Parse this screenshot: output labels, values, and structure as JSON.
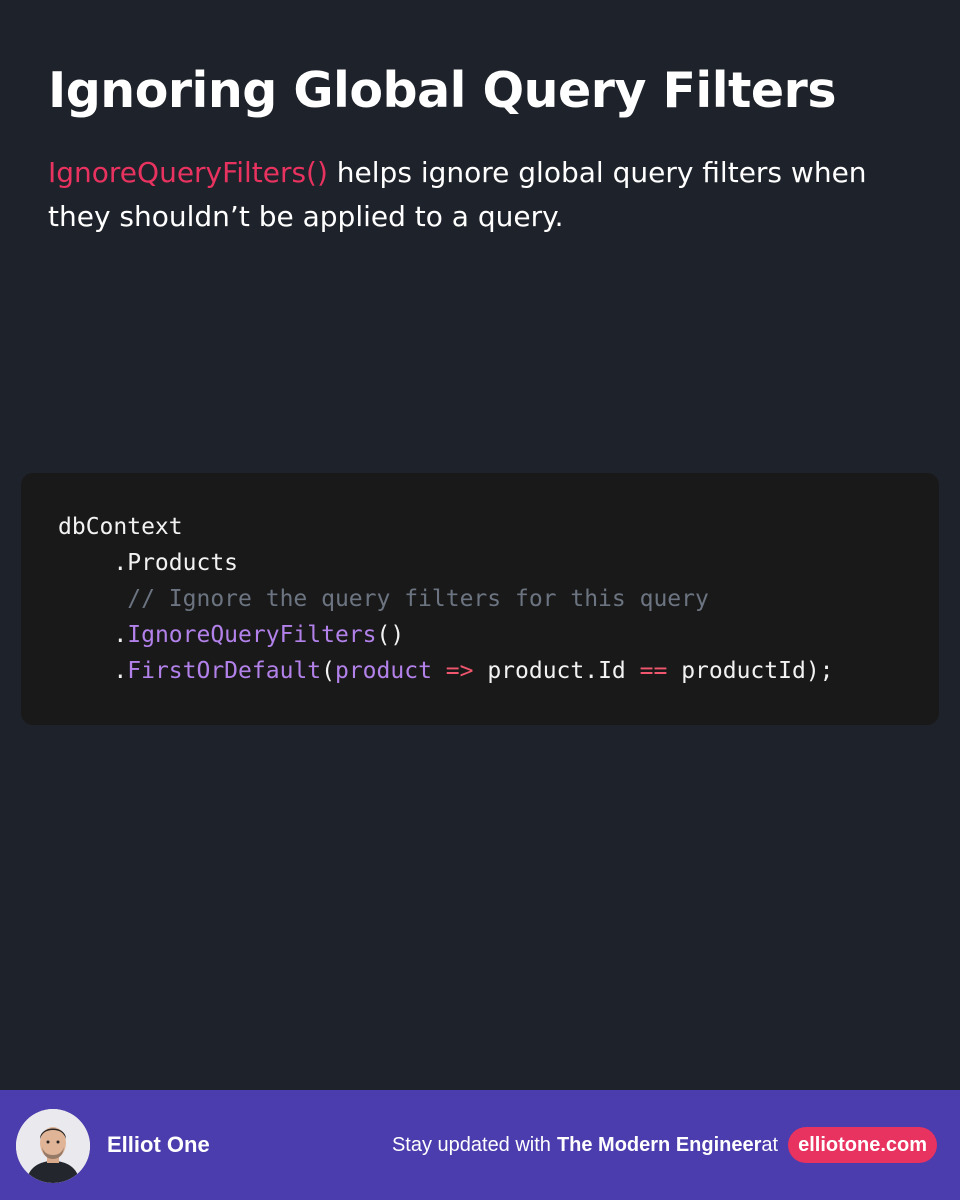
{
  "header": {
    "title": "Ignoring Global Query Filters",
    "subtitle_highlight": "IgnoreQueryFilters()",
    "subtitle_rest": " helps ignore global query filters when they shouldn’t be applied to a query."
  },
  "code": {
    "line1": "dbContext",
    "line2": "    .Products",
    "line3_indent": "     ",
    "line3_comment": "// Ignore the query filters for this query",
    "line4_prefix": "    .",
    "line4_method": "IgnoreQueryFilters",
    "line4_suffix": "()",
    "line5_prefix": "    .",
    "line5_method": "FirstOrDefault",
    "line5_open": "(",
    "line5_param": "product",
    "line5_arrow": " => ",
    "line5_expr": "product.Id ",
    "line5_eq": "==",
    "line5_rest": " productId);"
  },
  "footer": {
    "author": "Elliot One",
    "cta_prefix": "Stay updated with ",
    "cta_brand": "The Modern Engineer",
    "cta_at": " at",
    "site": "elliotone.com"
  },
  "colors": {
    "background": "#1e222a",
    "accent": "#e8325f",
    "footer": "#4b3dad",
    "code_bg": "#191919",
    "code_method": "#b281ea",
    "code_comment": "#6b7480"
  },
  "icons": {
    "avatar": "author-avatar"
  }
}
